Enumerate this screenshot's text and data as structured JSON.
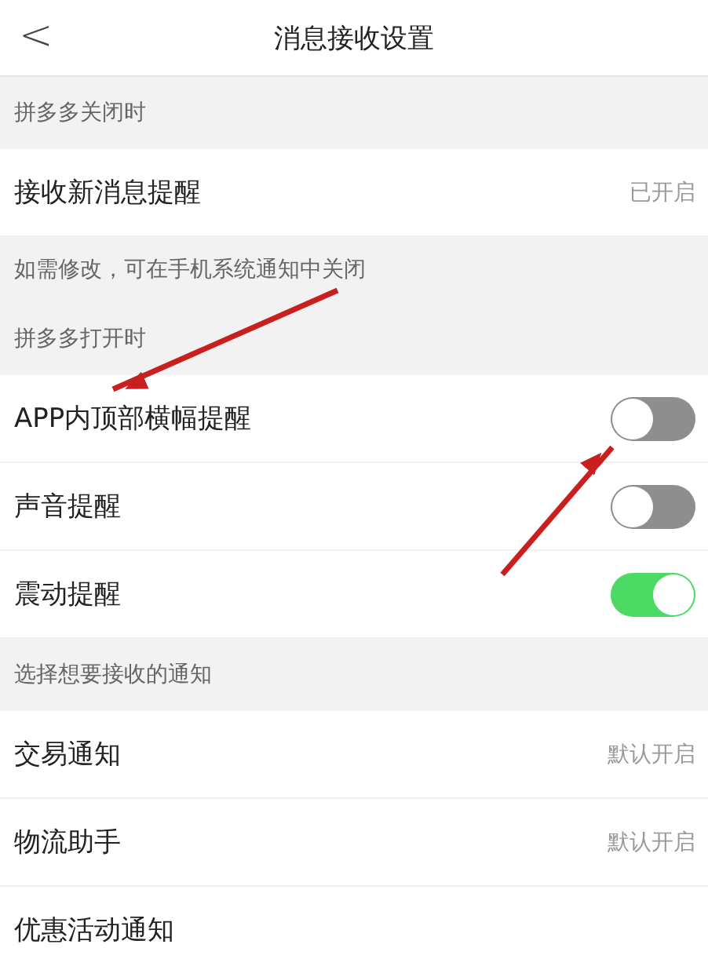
{
  "header": {
    "back": "<",
    "title": "消息接收设置"
  },
  "sections": [
    {
      "title": "拼多多关闭时",
      "rows": [
        {
          "kind": "value",
          "label": "接收新消息提醒",
          "value": "已开启"
        }
      ],
      "note": "如需修改，可在手机系统通知中关闭"
    },
    {
      "title": "拼多多打开时",
      "rows": [
        {
          "kind": "toggle",
          "label": "APP内顶部横幅提醒",
          "on": false
        },
        {
          "kind": "toggle",
          "label": "声音提醒",
          "on": false
        },
        {
          "kind": "toggle",
          "label": "震动提醒",
          "on": true
        }
      ]
    },
    {
      "title": "选择想要接收的通知",
      "rows": [
        {
          "kind": "value",
          "label": "交易通知",
          "value": "默认开启"
        },
        {
          "kind": "value",
          "label": "物流助手",
          "value": "默认开启"
        },
        {
          "kind": "value",
          "label": "优惠活动通知"
        }
      ]
    }
  ]
}
